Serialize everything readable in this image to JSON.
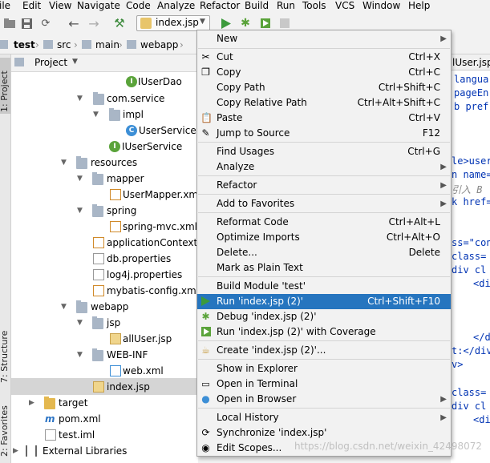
{
  "menubar": [
    "ile",
    "Edit",
    "View",
    "Navigate",
    "Code",
    "Analyze",
    "Refactor",
    "Build",
    "Run",
    "Tools",
    "VCS",
    "Window",
    "Help"
  ],
  "toolbar": {
    "run_config": "index.jsp"
  },
  "breadcrumb": [
    "test",
    "src",
    "main",
    "webapp"
  ],
  "left_tabs": {
    "project": "1: Project",
    "structure": "7: Structure",
    "favorites": "2: Favorites"
  },
  "project_panel": {
    "title": "Project"
  },
  "tree": [
    {
      "label": "IUserDao",
      "icon": "interface"
    },
    {
      "label": "com.service",
      "icon": "package"
    },
    {
      "label": "impl",
      "icon": "package"
    },
    {
      "label": "UserService",
      "icon": "class"
    },
    {
      "label": "IUserService",
      "icon": "interface"
    },
    {
      "label": "resources",
      "icon": "folder"
    },
    {
      "label": "mapper",
      "icon": "folder"
    },
    {
      "label": "UserMapper.xml",
      "icon": "xml"
    },
    {
      "label": "spring",
      "icon": "folder"
    },
    {
      "label": "spring-mvc.xml",
      "icon": "xml"
    },
    {
      "label": "applicationContext.xml",
      "icon": "xml"
    },
    {
      "label": "db.properties",
      "icon": "properties"
    },
    {
      "label": "log4j.properties",
      "icon": "properties"
    },
    {
      "label": "mybatis-config.xml",
      "icon": "xml"
    },
    {
      "label": "webapp",
      "icon": "folder"
    },
    {
      "label": "jsp",
      "icon": "folder"
    },
    {
      "label": "allUser.jsp",
      "icon": "jsp"
    },
    {
      "label": "WEB-INF",
      "icon": "folder"
    },
    {
      "label": "web.xml",
      "icon": "xml"
    },
    {
      "label": "index.jsp",
      "icon": "jsp"
    },
    {
      "label": "target",
      "icon": "folder-excluded"
    },
    {
      "label": "pom.xml",
      "icon": "maven"
    },
    {
      "label": "test.iml",
      "icon": "iml"
    },
    {
      "label": "External Libraries",
      "icon": "library"
    }
  ],
  "editor": {
    "tab": "lUser.jsp",
    "lines": [
      "langua",
      "pageEn",
      "b pref",
      "le>user",
      "n name=",
      "引入 B",
      "k href=",
      "ss=\"con",
      "class=",
      "div cl",
      "<di",
      "</d",
      "t:</div>",
      "v>",
      "class=",
      "div cl",
      "<di"
    ]
  },
  "context_menu": {
    "items": [
      {
        "label": "New",
        "shortcut": "",
        "submenu": true
      },
      {
        "label": "Cut",
        "shortcut": "Ctrl+X"
      },
      {
        "label": "Copy",
        "shortcut": "Ctrl+C"
      },
      {
        "label": "Copy Path",
        "shortcut": "Ctrl+Shift+C"
      },
      {
        "label": "Copy Relative Path",
        "shortcut": "Ctrl+Alt+Shift+C"
      },
      {
        "label": "Paste",
        "shortcut": "Ctrl+V"
      },
      {
        "label": "Jump to Source",
        "shortcut": "F12"
      },
      {
        "label": "Find Usages",
        "shortcut": "Ctrl+G"
      },
      {
        "label": "Analyze",
        "shortcut": "",
        "submenu": true
      },
      {
        "label": "Refactor",
        "shortcut": "",
        "submenu": true
      },
      {
        "label": "Add to Favorites",
        "shortcut": "",
        "submenu": true
      },
      {
        "label": "Reformat Code",
        "shortcut": "Ctrl+Alt+L"
      },
      {
        "label": "Optimize Imports",
        "shortcut": "Ctrl+Alt+O"
      },
      {
        "label": "Delete...",
        "shortcut": "Delete"
      },
      {
        "label": "Mark as Plain Text",
        "shortcut": ""
      },
      {
        "label": "Build Module 'test'",
        "shortcut": ""
      },
      {
        "label": "Run 'index.jsp (2)'",
        "shortcut": "Ctrl+Shift+F10",
        "highlighted": true
      },
      {
        "label": "Debug 'index.jsp (2)'",
        "shortcut": ""
      },
      {
        "label": "Run 'index.jsp (2)' with Coverage",
        "shortcut": ""
      },
      {
        "label": "Create 'index.jsp (2)'...",
        "shortcut": ""
      },
      {
        "label": "Show in Explorer",
        "shortcut": ""
      },
      {
        "label": "Open in Terminal",
        "shortcut": ""
      },
      {
        "label": "Open in Browser",
        "shortcut": "",
        "submenu": true
      },
      {
        "label": "Local History",
        "shortcut": "",
        "submenu": true
      },
      {
        "label": "Synchronize 'index.jsp'",
        "shortcut": ""
      },
      {
        "label": "Edit Scopes...",
        "shortcut": ""
      }
    ]
  },
  "watermark": "https://blog.csdn.net/weixin_42498072",
  "colors": {
    "highlight": "#2675bf",
    "run_green": "#3c9a3c",
    "debug_green": "#5aa33a"
  }
}
